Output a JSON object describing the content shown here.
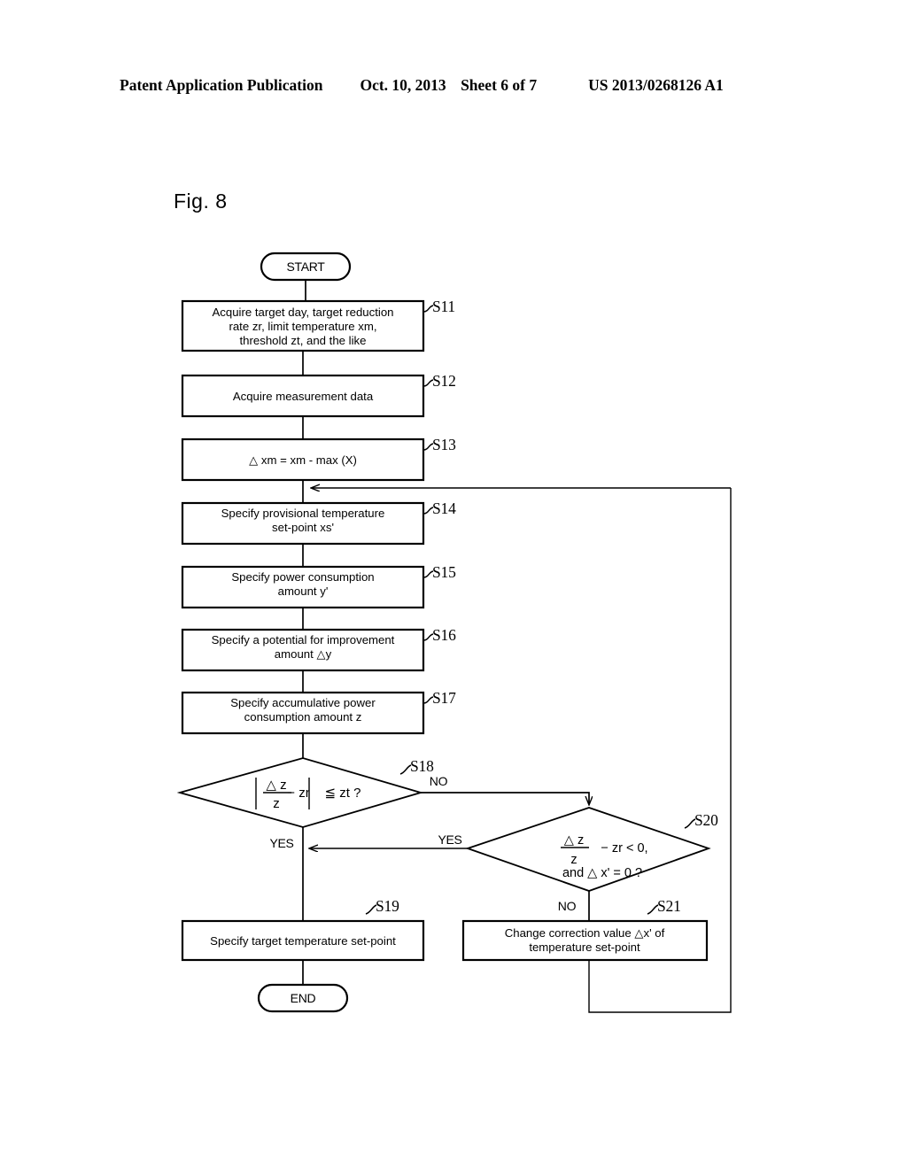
{
  "header": {
    "publication": "Patent Application Publication",
    "date": "Oct. 10, 2013",
    "sheet": "Sheet 6 of 7",
    "patent_number": "US 2013/0268126 A1"
  },
  "figure": {
    "label": "Fig. 8"
  },
  "nodes": {
    "start": {
      "id": "START",
      "label": "START"
    },
    "end": {
      "id": "END",
      "label": "END"
    },
    "s11": {
      "id": "S11",
      "line1": "Acquire target day, target reduction",
      "line2": "rate zr, limit temperature xm,",
      "line3": "threshold zt, and the like"
    },
    "s12": {
      "id": "S12",
      "line1": "Acquire measurement data"
    },
    "s13": {
      "id": "S13",
      "line1": "△ xm = xm - max (X)"
    },
    "s14": {
      "id": "S14",
      "line1": "Specify provisional temperature",
      "line2": "set-point xs'"
    },
    "s15": {
      "id": "S15",
      "line1": "Specify power consumption",
      "line2": "amount y'"
    },
    "s16": {
      "id": "S16",
      "line1": "Specify a potential for improvement",
      "line2": "amount △y"
    },
    "s17": {
      "id": "S17",
      "line1": "Specify accumulative power",
      "line2": "consumption amount z"
    },
    "s18": {
      "id": "S18",
      "formula_numerator": "△ z",
      "formula_denominator": "z",
      "formula_rest": "− zr",
      "formula_compare": "≦ zt ?",
      "yes_label": "YES",
      "no_label": "NO"
    },
    "s19": {
      "id": "S19",
      "line1": "Specify target temperature set-point"
    },
    "s20": {
      "id": "S20",
      "formula_numerator": "△ z",
      "formula_denominator": "z",
      "formula_rest": "− zr < 0,",
      "formula_line2": "and  △ x' = 0  ?",
      "yes_label": "YES",
      "no_label": "NO"
    },
    "s21": {
      "id": "S21",
      "line1": "Change correction value △x' of",
      "line2": "temperature set-point"
    }
  },
  "colors": {
    "ink": "#000000",
    "paper": "#ffffff"
  }
}
